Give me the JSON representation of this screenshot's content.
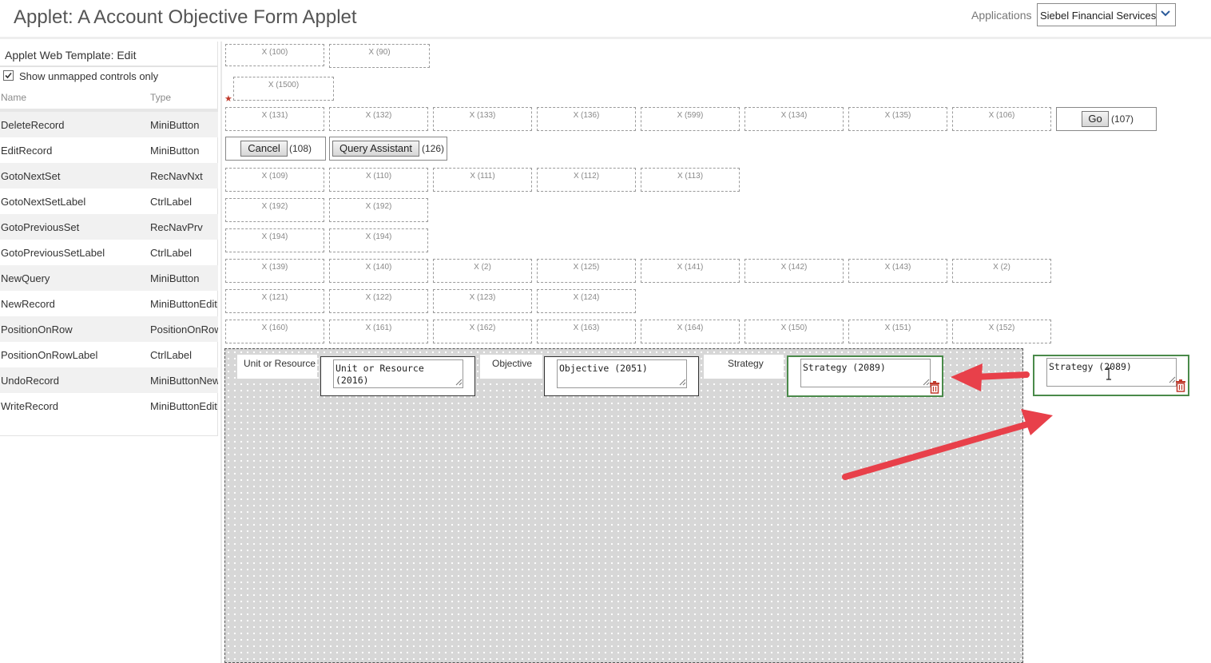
{
  "header": {
    "title": "Applet: A Account Objective Form Applet",
    "applications_label": "Applications",
    "applications_value": "Siebel Financial Services"
  },
  "left_panel": {
    "title": "Applet Web Template: Edit",
    "show_unmapped_label": "Show unmapped controls only",
    "show_unmapped_checked": true,
    "col_name": "Name",
    "col_type": "Type",
    "rows": [
      {
        "name": "DeleteRecord",
        "type": "MiniButton"
      },
      {
        "name": "EditRecord",
        "type": "MiniButton"
      },
      {
        "name": "GotoNextSet",
        "type": "RecNavNxt"
      },
      {
        "name": "GotoNextSetLabel",
        "type": "CtrlLabel"
      },
      {
        "name": "GotoPreviousSet",
        "type": "RecNavPrv"
      },
      {
        "name": "GotoPreviousSetLabel",
        "type": "CtrlLabel"
      },
      {
        "name": "NewQuery",
        "type": "MiniButton"
      },
      {
        "name": "NewRecord",
        "type": "MiniButtonEdit"
      },
      {
        "name": "PositionOnRow",
        "type": "PositionOnRow"
      },
      {
        "name": "PositionOnRowLabel",
        "type": "CtrlLabel"
      },
      {
        "name": "UndoRecord",
        "type": "MiniButtonNew"
      },
      {
        "name": "WriteRecord",
        "type": "MiniButtonEdit"
      }
    ]
  },
  "placeholders": {
    "row1": [
      "X (100)",
      "X (90)"
    ],
    "row2": [
      "X (1500)"
    ],
    "row3": [
      "X (131)",
      "X (132)",
      "X (133)",
      "X (136)",
      "X (599)",
      "X (134)",
      "X (135)",
      "X (106)"
    ],
    "row5": [
      "X (109)",
      "X (110)",
      "X (111)",
      "X (112)",
      "X (113)"
    ],
    "row6": [
      "X (192)",
      "X (192)"
    ],
    "row7": [
      "X (194)",
      "X (194)"
    ],
    "row8": [
      "X (139)",
      "X (140)",
      "X (2)",
      "X (125)",
      "X (141)",
      "X (142)",
      "X (143)",
      "X (2)"
    ],
    "row9": [
      "X (121)",
      "X (122)",
      "X (123)",
      "X (124)"
    ],
    "row10": [
      "X (160)",
      "X (161)",
      "X (162)",
      "X (163)",
      "X (164)",
      "X (150)",
      "X (151)",
      "X (152)"
    ]
  },
  "buttons": {
    "go_label": "Go",
    "go_id": "(107)",
    "cancel_label": "Cancel",
    "cancel_id": "(108)",
    "query_label": "Query Assistant",
    "query_id": "(126)"
  },
  "form": {
    "label_unit": "Unit or Resource",
    "field_unit": "Unit or Resource\n(2016)",
    "label_objective": "Objective",
    "field_objective": "Objective (2051)",
    "label_strategy": "Strategy",
    "field_strategy": "Strategy (2089)",
    "dragged_field_strategy": "Strategy (2089)"
  },
  "colors": {
    "arrow": "#e8404a",
    "selected_border": "#4a8a4a",
    "trash": "#c0392b"
  }
}
